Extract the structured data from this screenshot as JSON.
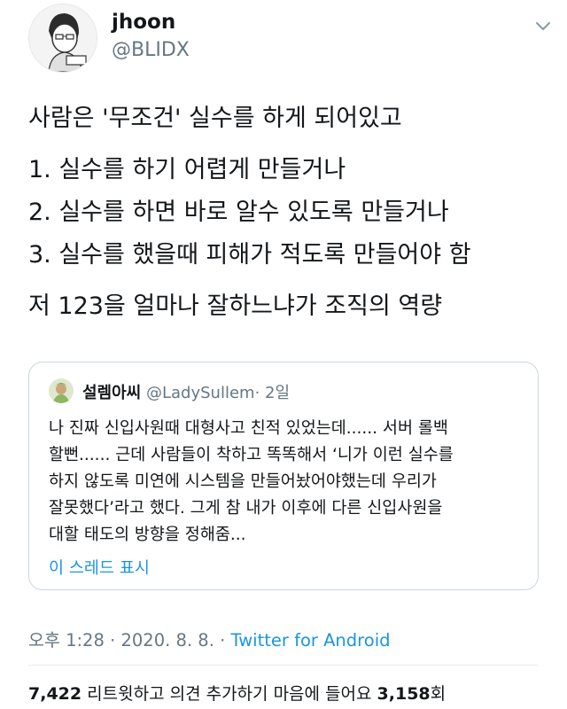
{
  "author": {
    "name": "jhoon",
    "handle": "@BLIDX"
  },
  "tweet": {
    "lines": [
      "사람은 '무조건' 실수를 하게 되어있고",
      "1. 실수를 하기 어렵게 만들거나",
      "2. 실수를 하면 바로 알수 있도록 만들거나",
      "3. 실수를 했을때 피해가 적도록 만들어야 함",
      "저 123을 얼마나 잘하느냐가 조직의 역량"
    ]
  },
  "quote": {
    "name": "설렘아씨",
    "handle": "@LadySullem",
    "dot": "·",
    "time": "2일",
    "lines": [
      "나 진짜 신입사원때 대형사고 친적 있었는데...... 서버 롤백",
      "할뻔...... 근데 사람들이 착하고 똑똑해서 ‘니가 이런 실수를",
      "하지 않도록 미연에 시스템을 만들어놨어야했는데 우리가",
      "잘못했다’라고 했다. 그게 참 내가 이후에 다른 신입사원을",
      "대할 태도의 방향을 정해줌..."
    ],
    "show_thread": "이 스레드 표시"
  },
  "meta": {
    "time": "오후 1:28",
    "sep1": "·",
    "date": "2020. 8. 8.",
    "sep2": "·",
    "source": "Twitter for Android"
  },
  "stats": {
    "retweets": "7,422",
    "retweets_label": "리트윗하고 의견 추가하기",
    "likes_label": "마음에 들어요",
    "likes": "3,158",
    "likes_suffix": "회"
  },
  "colors": {
    "accent": "#1b95e0",
    "secondary_text": "#657786",
    "border": "#ccd6dd"
  },
  "icons": {
    "caret": "chevron-down-icon"
  }
}
